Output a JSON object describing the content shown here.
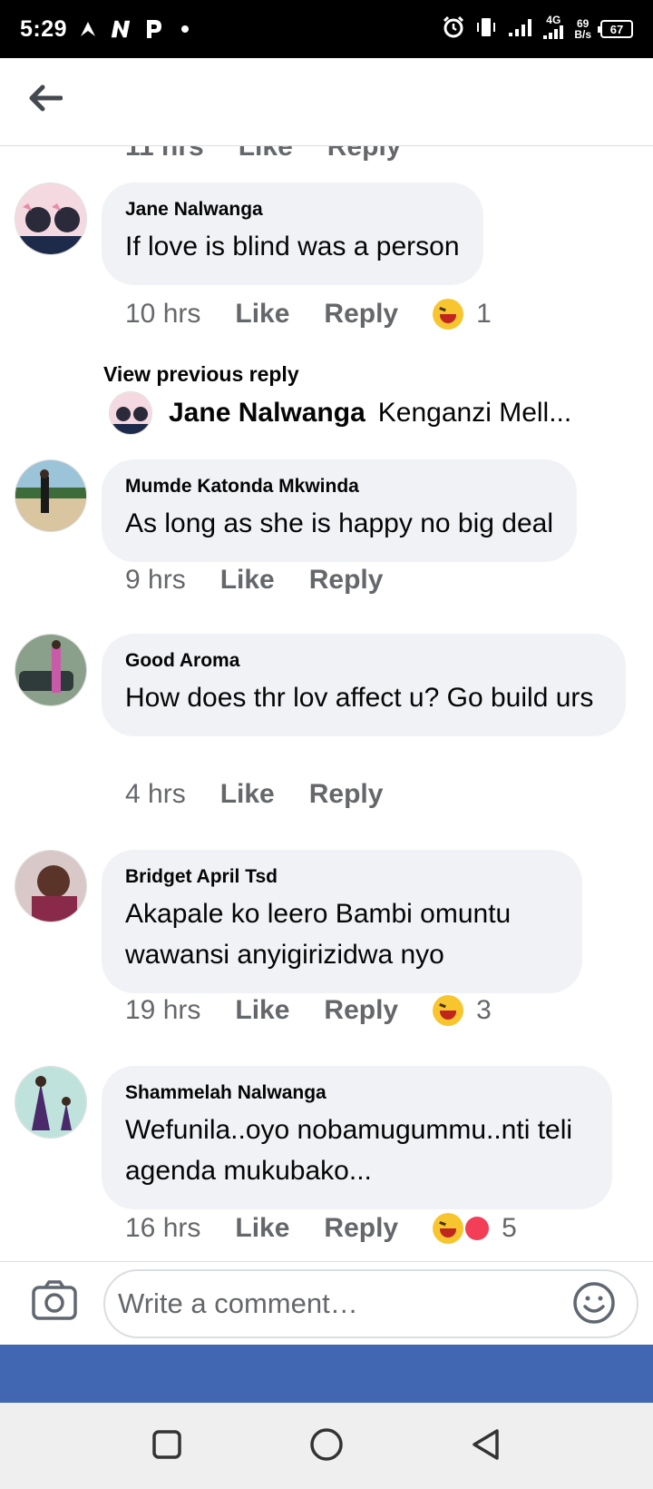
{
  "status_bar": {
    "time": "5:29",
    "network_type": "4G",
    "data_speed_value": "69",
    "data_speed_unit": "B/s",
    "battery": "67"
  },
  "cut_off_row": {
    "time": "11 hrs",
    "like": "Like",
    "reply": "Reply"
  },
  "comments": [
    {
      "author": "Jane Nalwanga",
      "text": "If love is blind was a person",
      "time": "10 hrs",
      "like": "Like",
      "reply": "Reply",
      "reaction_count": "1"
    },
    {
      "author": "Mumde Katonda Mkwinda",
      "text": "As long as she is happy no big deal",
      "time": "9 hrs",
      "like": "Like",
      "reply": "Reply"
    },
    {
      "author": "Good Aroma",
      "text": "How does thr lov affect u? Go build urs",
      "time": "4 hrs",
      "like": "Like",
      "reply": "Reply"
    },
    {
      "author": "Bridget April Tsd",
      "text": "Akapale ko leero Bambi omuntu wawansi anyigirizidwa nyo",
      "time": "19 hrs",
      "like": "Like",
      "reply": "Reply",
      "reaction_count": "3"
    },
    {
      "author": "Shammelah Nalwanga",
      "text": "Wefunila..oyo nobamugummu..nti teli agenda mukubako...",
      "time": "16 hrs",
      "like": "Like",
      "reply": "Reply",
      "reaction_count": "5"
    }
  ],
  "replies_preview": {
    "view_previous": "View previous reply",
    "author": "Jane Nalwanga",
    "text": "Kenganzi Mell..."
  },
  "composer": {
    "placeholder": "Write a comment…"
  },
  "colors": {
    "bubble": "#f0f2f5",
    "meta_text": "#65676b",
    "facebook_blue": "#4267b2"
  },
  "icons": [
    "back-arrow-icon",
    "camera-icon",
    "smiley-icon",
    "laughing-emoji-icon",
    "heart-reaction-icon",
    "square-recents-icon",
    "circle-home-icon",
    "triangle-back-icon"
  ]
}
